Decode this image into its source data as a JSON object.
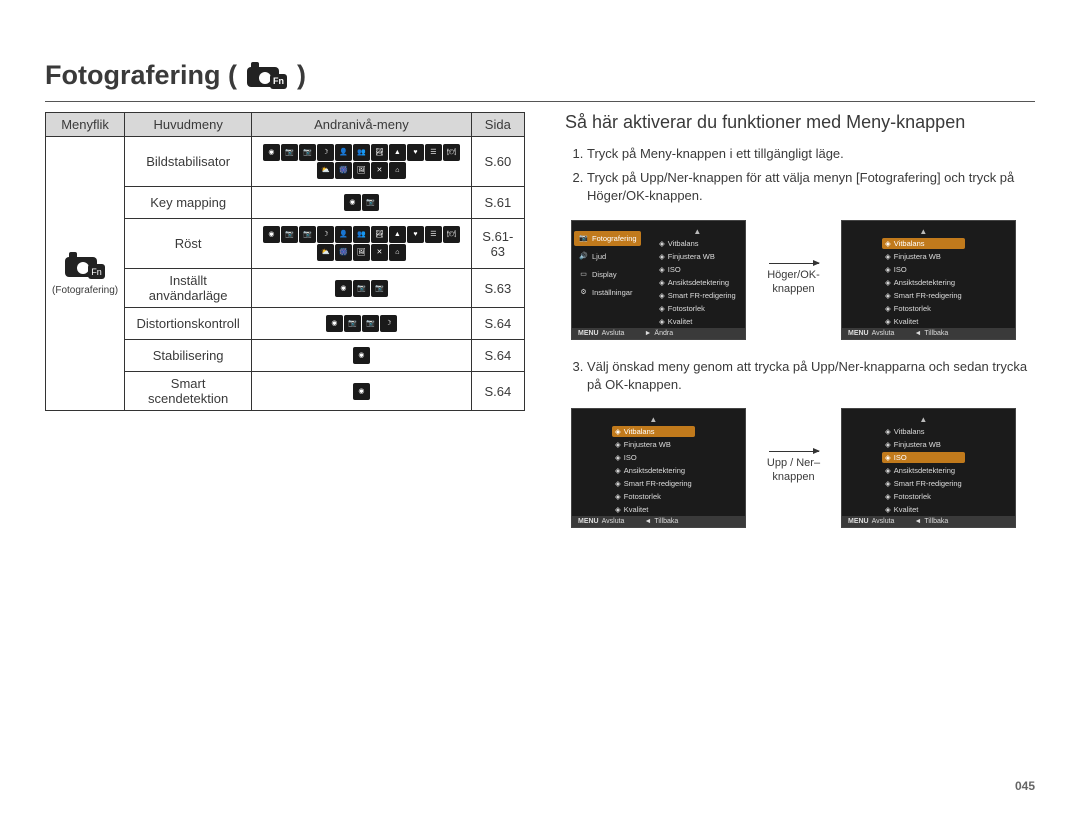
{
  "page_title_prefix": "Fotografering (",
  "page_title_suffix": " )",
  "fn_label": "Fn",
  "table": {
    "headers": [
      "Menyflik",
      "Huvudmeny",
      "Andranivå-meny",
      "Sida"
    ],
    "rowspan_label_top": "(Fotografering)",
    "rows": [
      {
        "name": "Bildstabilisator",
        "mode_count": 16,
        "page": "S.60"
      },
      {
        "name": "Key mapping",
        "mode_count": 2,
        "page": "S.61"
      },
      {
        "name": "Röst",
        "mode_count": 16,
        "page": "S.61-63"
      },
      {
        "name": "Inställt användarläge",
        "mode_count": 3,
        "page": "S.63"
      },
      {
        "name": "Distortionskontroll",
        "mode_count": 4,
        "page": "S.64"
      },
      {
        "name": "Stabilisering",
        "mode_count": 1,
        "page": "S.64"
      },
      {
        "name": "Smart scendetektion",
        "mode_count": 1,
        "page": "S.64"
      }
    ]
  },
  "right": {
    "heading": "Så här aktiverar du funktioner med Meny-knappen",
    "steps": [
      "Tryck på Meny-knappen i ett tillgängligt läge.",
      "Tryck på Upp/Ner-knappen för att välja menyn [Fotografering] och tryck på Höger/OK-knappen.",
      "Välj önskad meny genom att trycka på Upp/Ner-knapparna och sedan trycka på OK-knappen."
    ],
    "arrow1": "Höger/OK-knappen",
    "arrow2": "Upp / Ner–knappen"
  },
  "screen_tabs": [
    {
      "icon": "📷",
      "label": "Fotografering",
      "active": true
    },
    {
      "icon": "🔊",
      "label": "Ljud"
    },
    {
      "icon": "▭",
      "label": "Display"
    },
    {
      "icon": "⚙",
      "label": "Inställningar"
    }
  ],
  "screen_options": [
    "Vitbalans",
    "Finjustera WB",
    "ISO",
    "Ansiktsdetektering",
    "Smart FR-redigering",
    "Fotostorlek",
    "Kvalitet"
  ],
  "footer_left": "Avsluta",
  "footer_right_andra": "Ändra",
  "footer_right_tillbaka": "Tillbaka",
  "footer_btn_menu": "MENU",
  "footer_btn_play": "►",
  "footer_btn_left": "◄",
  "page_number": "045",
  "icon_glyphs": [
    "◉",
    "📷",
    "📷",
    "☽",
    "👤",
    "👥",
    "🏞",
    "▲",
    "♥",
    "☰",
    "🍽",
    "⛅",
    "🎆",
    "🖼",
    "✕",
    "⌂"
  ]
}
